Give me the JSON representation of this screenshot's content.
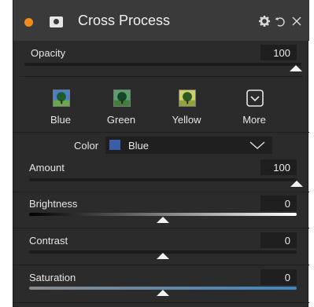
{
  "header": {
    "title": "Cross Process",
    "status_color": "#f28b1a",
    "icons": [
      "mask-icon",
      "gear-icon",
      "undo-icon",
      "close-icon"
    ]
  },
  "opacity": {
    "label": "Opacity",
    "value": "100",
    "level": 1.0
  },
  "presets": [
    {
      "label": "Blue",
      "icon": "tree-thumbnail-blue"
    },
    {
      "label": "Green",
      "icon": "tree-thumbnail-green"
    },
    {
      "label": "Yellow",
      "icon": "tree-thumbnail-yellow"
    },
    {
      "label": "More",
      "icon": "chevron-box-icon"
    }
  ],
  "color": {
    "label": "Color",
    "value": "Blue",
    "swatch": "#3a5ea8"
  },
  "sliders": [
    {
      "label": "Amount",
      "value": "100",
      "level": 1.0
    },
    {
      "label": "Brightness",
      "value": "0",
      "level": 0.5
    },
    {
      "label": "Contrast",
      "value": "0",
      "level": 0.5
    },
    {
      "label": "Saturation",
      "value": "0",
      "level": 0.5
    }
  ]
}
